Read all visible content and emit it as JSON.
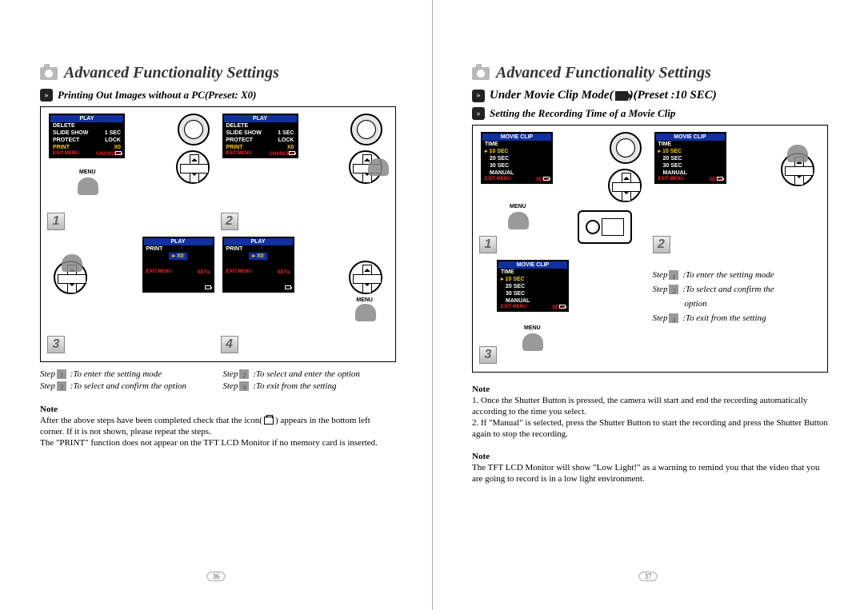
{
  "left": {
    "title": "Advanced Functionality Settings",
    "section": "Printing Out Images without a PC(Preset: X0)",
    "lcd_play": {
      "header": "PLAY",
      "rows": [
        {
          "l": "DELETE",
          "r": ""
        },
        {
          "l": "SLIDE SHOW",
          "r": "1 SEC"
        },
        {
          "l": "PROTECT",
          "r": "LOCK"
        }
      ],
      "highlight": {
        "l": "PRINT",
        "r": "X0"
      },
      "footer": {
        "l": "EXIT:MENU",
        "r": "CHANGE:▸"
      }
    },
    "lcd_print": {
      "header": "PLAY",
      "row_plain": "PRINT",
      "value": "X0",
      "footer": {
        "l": "EXIT:MENU",
        "r": "SET:▸"
      }
    },
    "menu_label": "MENU",
    "badges": [
      "1",
      "2",
      "3",
      "4"
    ],
    "steps": {
      "s1": "To enter the setting mode",
      "s2": "To select and enter the option",
      "s3": "To select and confirm the option",
      "s4": "To exit from the setting"
    },
    "step_word": "Step",
    "note": {
      "h": "Note",
      "p1a": "After the above steps have been completed check that the icon(",
      "p1b": ") appears in the bottom left corner. If it is not shown, please repeat the steps.",
      "p2": "The \"PRINT\" function does not appear on the TFT LCD Monitor if no memory card is inserted."
    },
    "pagenum": "36"
  },
  "right": {
    "title": "Advanced Functionality Settings",
    "section_a": "Under Movie Clip Mode(",
    "section_b": ")(Preset :10 SEC)",
    "subsection": "Setting the Recording Time of a Movie Clip",
    "lcd_movie": {
      "header": "MOVIE CLIP",
      "row_label": "TIME",
      "rows": [
        "10 SEC",
        "20 SEC",
        "30 SEC",
        "MANUAL"
      ],
      "highlight_prefix": "▸",
      "footer": {
        "l": "EXIT:MENU",
        "r": "SET:▸"
      }
    },
    "menu_label": "MENU",
    "badges": [
      "1",
      "2",
      "3"
    ],
    "steps": {
      "s1": "To enter the setting mode",
      "s2a": "To select and confirm the",
      "s2b": "option",
      "s3": "To exit from the setting"
    },
    "step_word": "Step",
    "note1": {
      "h": "Note",
      "p1": "1. Once the Shutter Button is pressed, the camera will start and end the recording automatically according to the time you select.",
      "p2": "2. If \"Manual\" is selected, press the Shutter Button to start the recording and press the Shutter Button again to stop the recording."
    },
    "note2": {
      "h": "Note",
      "p1": "The TFT LCD Monitor will show \"Low Light!\" as a warning to remind you that the video that you are going to record is in a low light environment."
    },
    "pagenum": "37"
  }
}
